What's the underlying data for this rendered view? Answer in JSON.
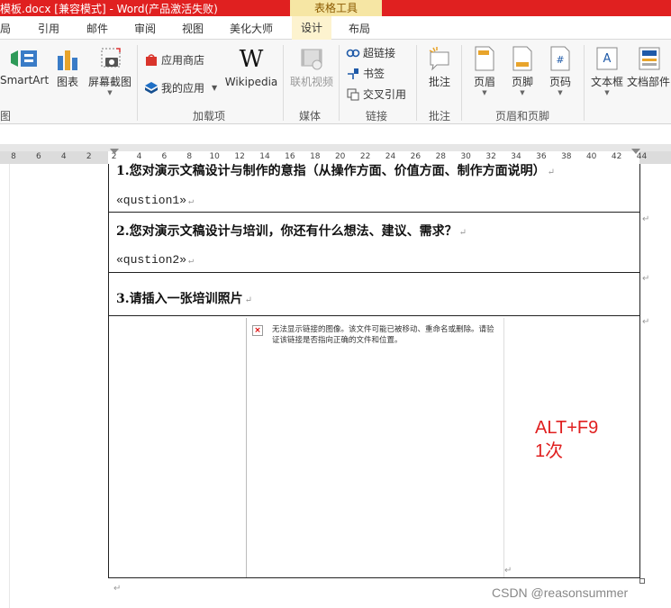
{
  "titlebar": {
    "title": "模板.docx [兼容模式] -  Word(产品激活失败)",
    "context_label": "表格工具",
    "colors": {
      "bar": "#e02020",
      "context": "#f6e6a4"
    }
  },
  "tabs": [
    "局",
    "引用",
    "邮件",
    "审阅",
    "视图",
    "美化大师",
    "设计",
    "布局"
  ],
  "ribbon": {
    "smartart": "SmartArt",
    "chart": "图表",
    "screenshot": "屏幕截图",
    "store": "应用商店",
    "my_apps": "我的应用",
    "wikipedia": "Wikipedia",
    "online_video": "联机视频",
    "hyperlink": "超链接",
    "bookmark": "书签",
    "cross_ref": "交叉引用",
    "comment": "批注",
    "header": "页眉",
    "footer": "页脚",
    "page_number": "页码",
    "textbox": "文本框",
    "doc_parts": "文档部件",
    "groups": {
      "illustrations": "图",
      "addins": "加载项",
      "media": "媒体",
      "links": "链接",
      "comments": "批注",
      "header_footer": "页眉和页脚"
    }
  },
  "ruler": {
    "numbers": [
      "8",
      "6",
      "4",
      "2",
      "2",
      "4",
      "6",
      "8",
      "10",
      "12",
      "14",
      "16",
      "18",
      "20",
      "22",
      "24",
      "26",
      "28",
      "30",
      "32",
      "34",
      "36",
      "38",
      "40",
      "42",
      "44"
    ]
  },
  "document": {
    "q1": "1.您对演示文稿设计与制作的意指（从操作方面、价值方面、制作方面说明）",
    "a1": "«qustion1»",
    "q2": "2.您对演示文稿设计与培训，你还有什么想法、建议、需求？",
    "a2": "«qustion2»",
    "q3": "3.请插入一张培训照片",
    "image_error": "无法显示链接的图像。该文件可能已被移动、重命名或删除。请验证该链接是否指向正确的文件和位置。"
  },
  "annotation": {
    "line1": "ALT+F9",
    "line2": "1次",
    "color": "#e02020"
  },
  "watermark": "CSDN @reasonsummer"
}
